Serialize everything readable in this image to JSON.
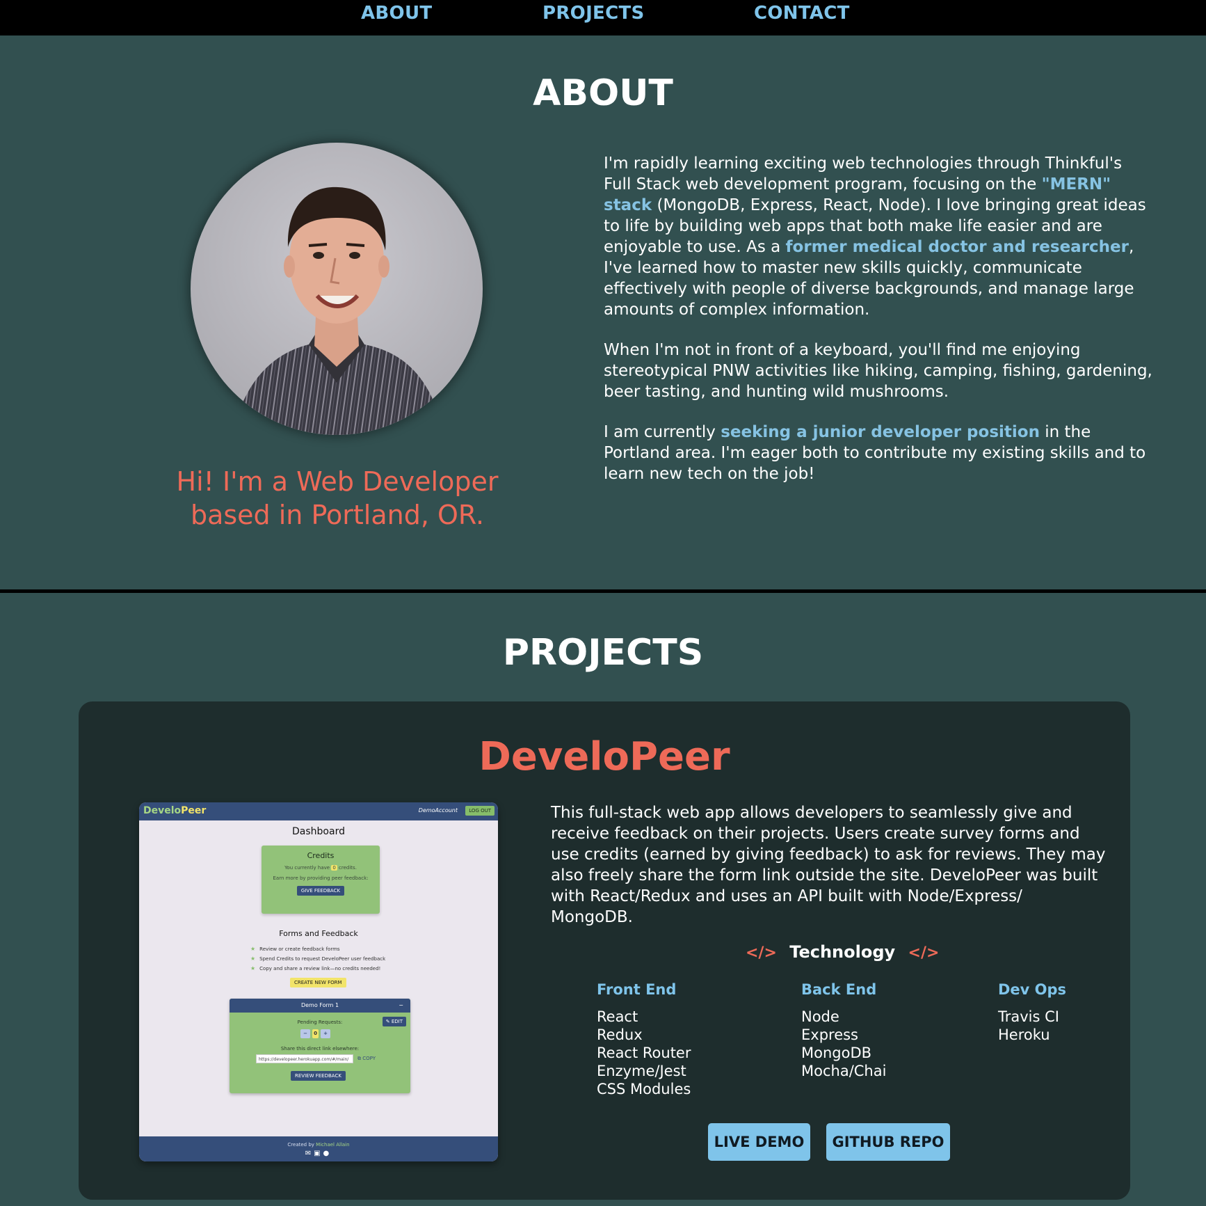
{
  "nav": {
    "about": "ABOUT",
    "projects": "PROJECTS",
    "contact": "CONTACT"
  },
  "about": {
    "title": "ABOUT",
    "tagline_line1": "Hi! I'm a Web Developer",
    "tagline_line2": "based in Portland, OR.",
    "p1": {
      "a": "I'm rapidly learning exciting web technologies through Thinkful's Full Stack web development program, focusing on the ",
      "b": "\"MERN\" stack",
      "c": " (MongoDB, Express, React, Node). I love bringing great ideas to life by building web apps that both make life easier and are enjoyable to use. As a ",
      "d": "former medical doctor and researcher",
      "e": ", I've learned how to master new skills quickly, communicate effectively with people of diverse backgrounds, and manage large amounts of complex information."
    },
    "p2": "When I'm not in front of a keyboard, you'll find me enjoying stereotypical PNW activities like hiking, camping, fishing, gardening, beer tasting, and hunting wild mushrooms.",
    "p3": {
      "a": "I am currently ",
      "b": "seeking a junior developer position",
      "c": " in the Portland area. I'm eager both to contribute my existing skills and to learn new tech on the job!"
    }
  },
  "projects": {
    "title": "PROJECTS",
    "items": [
      {
        "name": "DeveloPeer",
        "description": "This full-stack web app allows developers to seamlessly give and receive feedback on their projects. Users create survey forms and use credits (earned by giving feedback) to ask for reviews. They may also freely share the form link outside the site. DeveloPeer was built with React/Redux and uses an API built with Node/Express/ MongoDB.",
        "tech_title": "Technology",
        "tech_icon": "</>",
        "columns": [
          {
            "title": "Front End",
            "items": [
              "React",
              "Redux",
              "React Router",
              "Enzyme/Jest",
              "CSS Modules"
            ]
          },
          {
            "title": "Back End",
            "items": [
              "Node",
              "Express",
              "MongoDB",
              "Mocha/Chai"
            ]
          },
          {
            "title": "Dev Ops",
            "items": [
              "Travis CI",
              "Heroku"
            ]
          }
        ],
        "buttons": {
          "demo": "LIVE DEMO",
          "repo": "GITHUB REPO"
        },
        "screenshot": {
          "logo_a": "Develo",
          "logo_b": "Peer",
          "account": "DemoAccount",
          "logout": "LOG OUT",
          "dashboard": "Dashboard",
          "credits_title": "Credits",
          "credits_pre": "You currently have",
          "credits_value": "0",
          "credits_post": "credits.",
          "credits_sub": "Earn more by providing peer feedback:",
          "give_feedback": "GIVE FEEDBACK",
          "forms_title": "Forms and Feedback",
          "bullets": [
            "Review or create feedback forms",
            "Spend Credits to request DeveloPeer user feedback",
            "Copy and share a review link—no credits needed!"
          ],
          "create_form": "CREATE NEW FORM",
          "form_name": "Demo Form 1",
          "collapse": "−",
          "edit": "EDIT",
          "pending": "Pending Requests:",
          "minus": "−",
          "pending_value": "0",
          "plus": "+",
          "share": "Share this direct link elsewhere:",
          "url": "https://developeer.herokuapp.com/#/main/",
          "copy": "COPY",
          "review": "REVIEW FEEDBACK",
          "footer_pre": "Created by",
          "footer_name": "Michael Allain"
        }
      }
    ]
  },
  "colors": {
    "background": "#325050",
    "nav": "#000000",
    "accent_blue": "#7fc4ea",
    "accent_coral": "#ee6a58",
    "card": "#1e2d2d"
  },
  "icons": [
    "code-icon",
    "envelope-icon",
    "linkedin-icon",
    "github-icon",
    "star-icon"
  ]
}
